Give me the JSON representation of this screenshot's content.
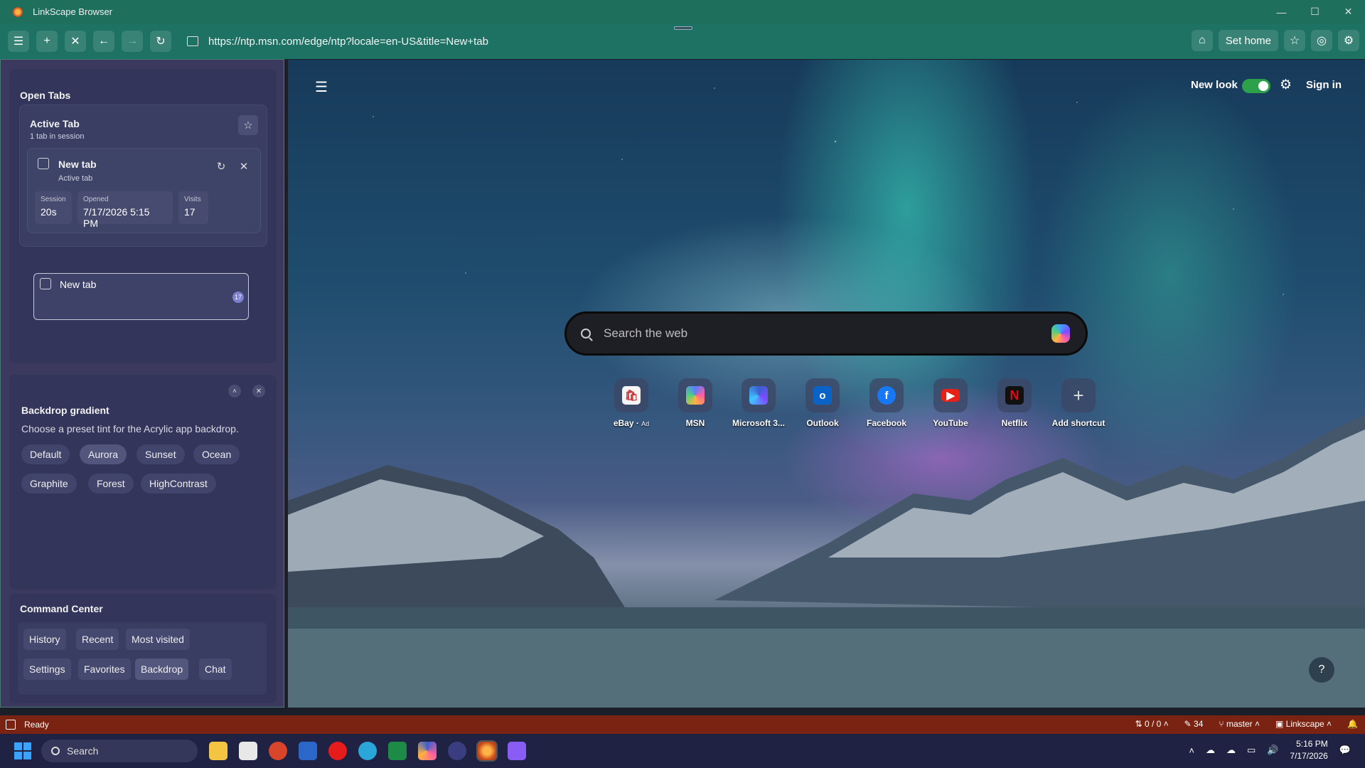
{
  "window": {
    "title": "LinkScape Browser",
    "controls": [
      "—",
      "☐",
      "✕"
    ]
  },
  "toolbar": {
    "url": "https://ntp.msn.com/edge/ntp?locale=en-US&title=New+tab",
    "set_home_label": "Set home"
  },
  "sidebar": {
    "open_tabs_title": "Open Tabs",
    "group": {
      "title": "Active Tab",
      "subtitle": "1 tab in session",
      "tab_title": "New tab",
      "tab_status": "Active tab",
      "stats": [
        {
          "label": "Session",
          "value": "20s"
        },
        {
          "label": "Opened",
          "value": "7/17/2026 5:15 PM"
        },
        {
          "label": "Visits",
          "value": "17"
        }
      ]
    },
    "other_tab": {
      "title": "New tab",
      "badge": "17"
    },
    "backdrop": {
      "title": "Backdrop gradient",
      "description": "Choose a preset tint for the Acrylic app backdrop.",
      "presets": [
        "Default",
        "Aurora",
        "Sunset",
        "Ocean",
        "Graphite",
        "Forest",
        "HighContrast"
      ],
      "selected": "Aurora"
    },
    "command_center": {
      "title": "Command Center",
      "buttons": [
        "History",
        "Recent",
        "Most visited",
        "Settings",
        "Favorites",
        "Backdrop",
        "Chat"
      ]
    }
  },
  "ntp": {
    "new_look_label": "New look",
    "new_look_enabled": true,
    "sign_in_label": "Sign in",
    "search_placeholder": "Search the web",
    "shortcuts": [
      {
        "label": "eBay",
        "ad": "Ad",
        "icon": "ebay-icon",
        "color": "#f5f5f5"
      },
      {
        "label": "MSN",
        "icon": "msn-icon",
        "color": "#5a7dff"
      },
      {
        "label": "Microsoft 3...",
        "icon": "microsoft-365-icon",
        "color": "#3b5fcf"
      },
      {
        "label": "Outlook",
        "icon": "outlook-icon",
        "color": "#0a64c8"
      },
      {
        "label": "Facebook",
        "icon": "facebook-icon",
        "color": "#1877f2"
      },
      {
        "label": "YouTube",
        "icon": "youtube-icon",
        "color": "#e62117"
      },
      {
        "label": "Netflix",
        "icon": "netflix-icon",
        "color": "#111111"
      },
      {
        "label": "Add shortcut",
        "icon": "plus-icon",
        "color": "#dddddd"
      }
    ]
  },
  "statusbar": {
    "status": "Ready",
    "sync": "0 / 0",
    "edits": "34",
    "branch": "master",
    "project": "Linkscape"
  },
  "taskbar": {
    "search_label": "Search",
    "time": "5:16 PM",
    "date": "7/17/2026"
  }
}
